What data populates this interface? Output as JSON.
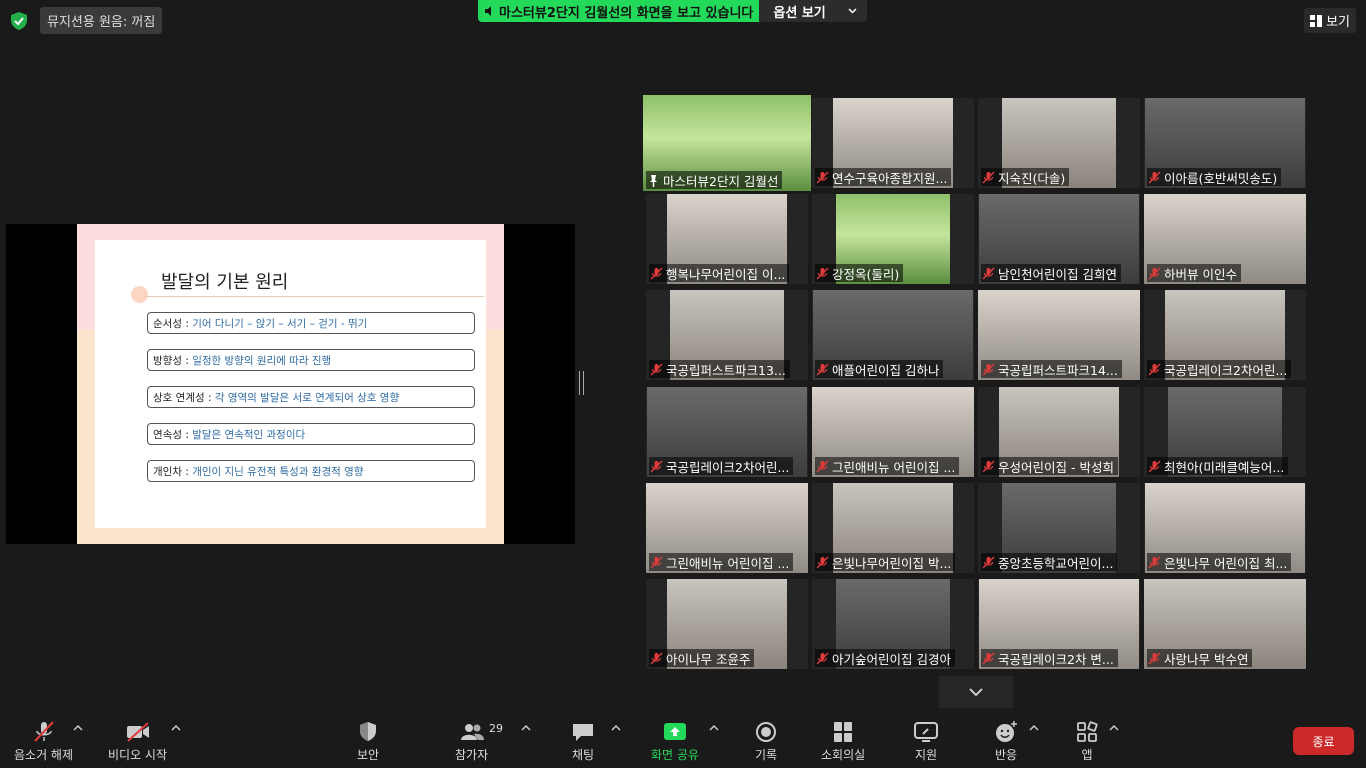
{
  "top": {
    "audio_status": "뮤지션용 원음: 꺼짐",
    "share_banner": "마스터뷰2단지 김월선의 화면을 보고 있습니다",
    "view_options": "옵션 보기",
    "view_button": "보기"
  },
  "slide": {
    "title": "발달의 기본 원리",
    "rows": [
      {
        "label": "순서성 : ",
        "desc": "기어 다니기 – 앉기 – 서기 – 걷기 - 뛰기"
      },
      {
        "label": "방향성 : ",
        "desc": "일정한 방향의 원리에 따라 진행"
      },
      {
        "label": "상호 연계성 : ",
        "desc": "각 영역의 발달은 서로 연계되어 상호 영향"
      },
      {
        "label": "연속성 : ",
        "desc": "발달은 연속적인 과정이다"
      },
      {
        "label": "개인차 : ",
        "desc": "개인이 지닌 유전적 특성과 환경적 영향"
      }
    ]
  },
  "participants": [
    "마스터뷰2단지 김월선",
    "연수구육아종합지원...",
    "지숙진(다솔)",
    "이아름(호반써밋송도)",
    "행복나무어린이집 이...",
    "강정옥(둘리)",
    "남인천어린이집 김희연",
    "하버뷰  이인수",
    "국공립퍼스트파크13...",
    "애플어린이집 김하나",
    "국공립퍼스트파크14...",
    "국공립레이크2차어린...",
    "국공립레이크2차어린...",
    "그린애비뉴 어린이집 ...",
    "우성어린이집 - 박성희",
    "최현아(미래클예능어...",
    "그린애비뉴 어린이집 ...",
    "은빛나무어린이집 박...",
    "중앙초등학교어린이...",
    "은빛나무 어린이집 최...",
    "아이나무 조윤주",
    "아기숲어린이집 김경아",
    "국공립레이크2차 변...",
    "사랑나무 박수연"
  ],
  "toolbar": {
    "unmute": "음소거 해제",
    "start_video": "비디오 시작",
    "security": "보안",
    "participants": "참가자",
    "participants_count": "29",
    "chat": "채팅",
    "share_screen": "화면 공유",
    "record": "기록",
    "breakout": "소회의실",
    "support": "지원",
    "reactions": "반응",
    "apps": "앱",
    "end": "종료"
  },
  "colors": {
    "share_green": "#23d959",
    "active_speaker": "#e8f04a",
    "end_red": "#cc2a2a",
    "mute_red": "#e03b3b"
  }
}
